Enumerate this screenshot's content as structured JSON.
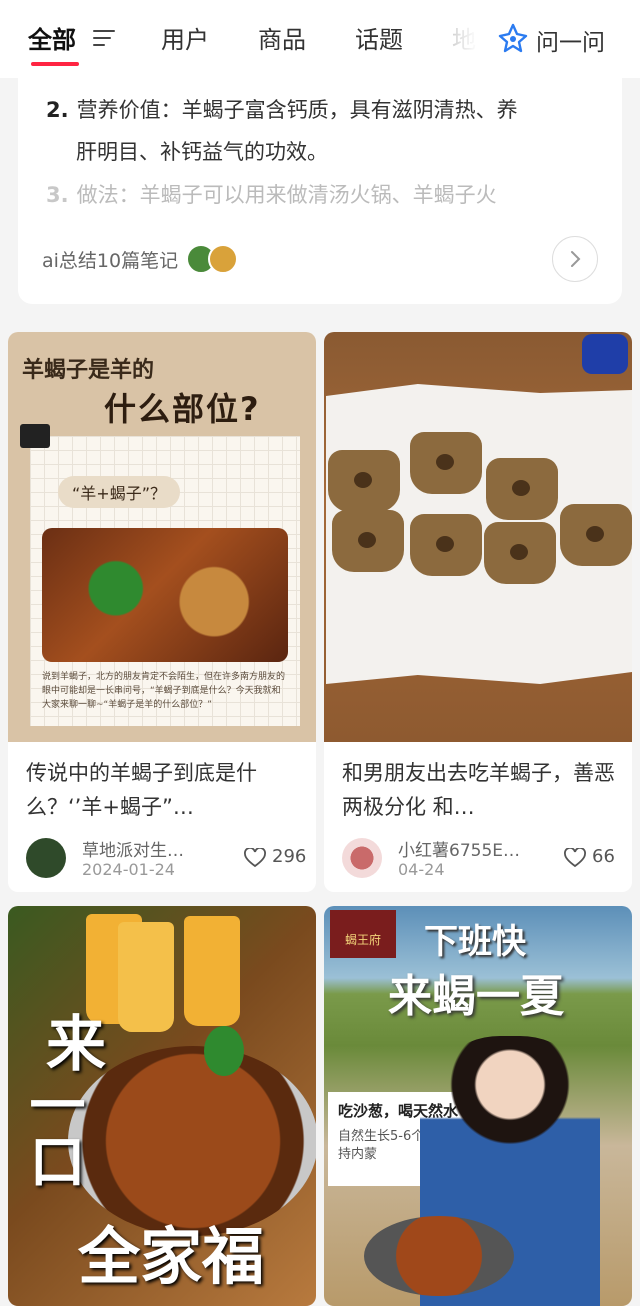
{
  "header": {
    "tabs": [
      {
        "label": "全部"
      },
      {
        "label": "用户"
      },
      {
        "label": "商品"
      },
      {
        "label": "话题"
      },
      {
        "label": "地"
      }
    ],
    "ask_label": "问一问",
    "accent_color": "#ff2442"
  },
  "summary": {
    "line2_num": "2.",
    "line2_text": "营养价值：羊蝎子富含钙质，具有滋阴清热、养",
    "line2_cont": "肝明目、补钙益气的功效。",
    "line3_num": "3.",
    "line3_text": "做法：羊蝎子可以用来做清汤火锅、羊蝎子火",
    "footer_text": "ai总结10篇笔记"
  },
  "notes": [
    {
      "cover": {
        "title1": "羊蝎子是羊的",
        "title2": "什么部位?",
        "bubble": "“羊+蝎子”？",
        "caption": "说到羊蝎子，北方的朋友肯定不会陌生，但在许多南方朋友的眼中可能却是一长串问号，“羊蝎子到底是什么？今天我就和大家来聊一聊~“羊蝎子是羊的什么部位？”"
      },
      "title": "传说中的羊蝎子到底是什么？‘’羊+蝎子”…",
      "author": "草地派对生…",
      "date": "2024-01-24",
      "likes": "296"
    },
    {
      "title": "和男朋友出去吃羊蝎子，善恶两极分化 和…",
      "author": "小红薯6755E…",
      "date": "04-24",
      "likes": "66"
    },
    {
      "cover": {
        "text1": "来",
        "text2": "一口",
        "text3": "全家福"
      }
    },
    {
      "cover": {
        "logo": "蝎王府",
        "title1": "下班快",
        "title2": "来蝎一夏",
        "board1": "吃沙葱，喝天然水",
        "board2": "自然生长5-6个月 23年坚持内蒙"
      }
    }
  ]
}
